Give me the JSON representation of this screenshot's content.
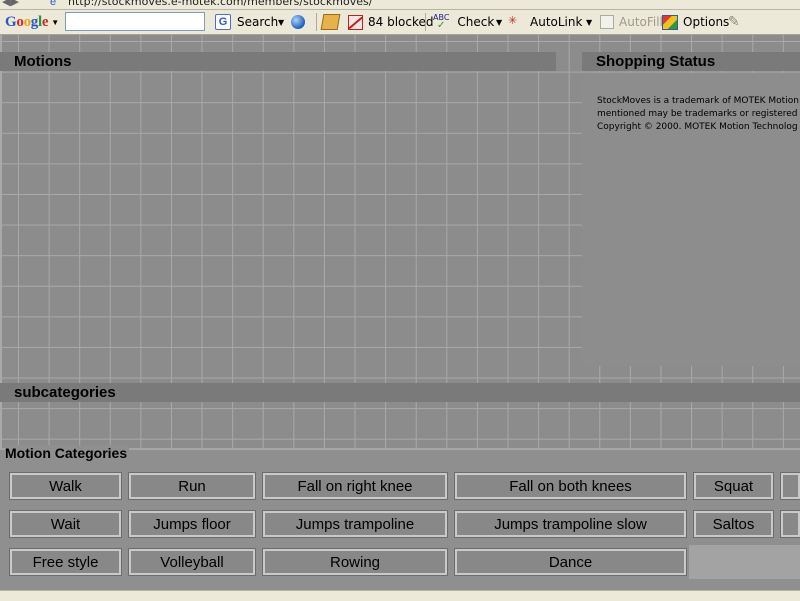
{
  "address_bar": {
    "url": "http://stockmoves.e-motek.com/members/stockmoves/"
  },
  "toolbar": {
    "logo_letters": [
      "G",
      "o",
      "o",
      "g",
      "l",
      "e"
    ],
    "search_value": "",
    "search_label": "Search",
    "blocked_label": "84 blocked",
    "check_label": "Check",
    "autolink_label": "AutoLink",
    "autofill_label": "AutoFill",
    "options_label": "Options"
  },
  "motions": {
    "title": "Motions"
  },
  "shopping": {
    "title": "Shopping Status",
    "lines": [
      "StockMoves is a trademark of MOTEK Motion",
      "mentioned may be trademarks or registered tra",
      "Copyright © 2000. MOTEK Motion Technolog"
    ]
  },
  "subcategories": {
    "title": "subcategories"
  },
  "categories": {
    "title": "Motion Categories",
    "buttons": [
      "Walk",
      "Run",
      "Fall on right knee",
      "Fall on both knees",
      "Squat",
      "Wait",
      "Jumps floor",
      "Jumps trampoline",
      "Jumps trampoline slow",
      "Saltos",
      "Free style",
      "Volleyball",
      "Rowing",
      "Dance"
    ]
  }
}
